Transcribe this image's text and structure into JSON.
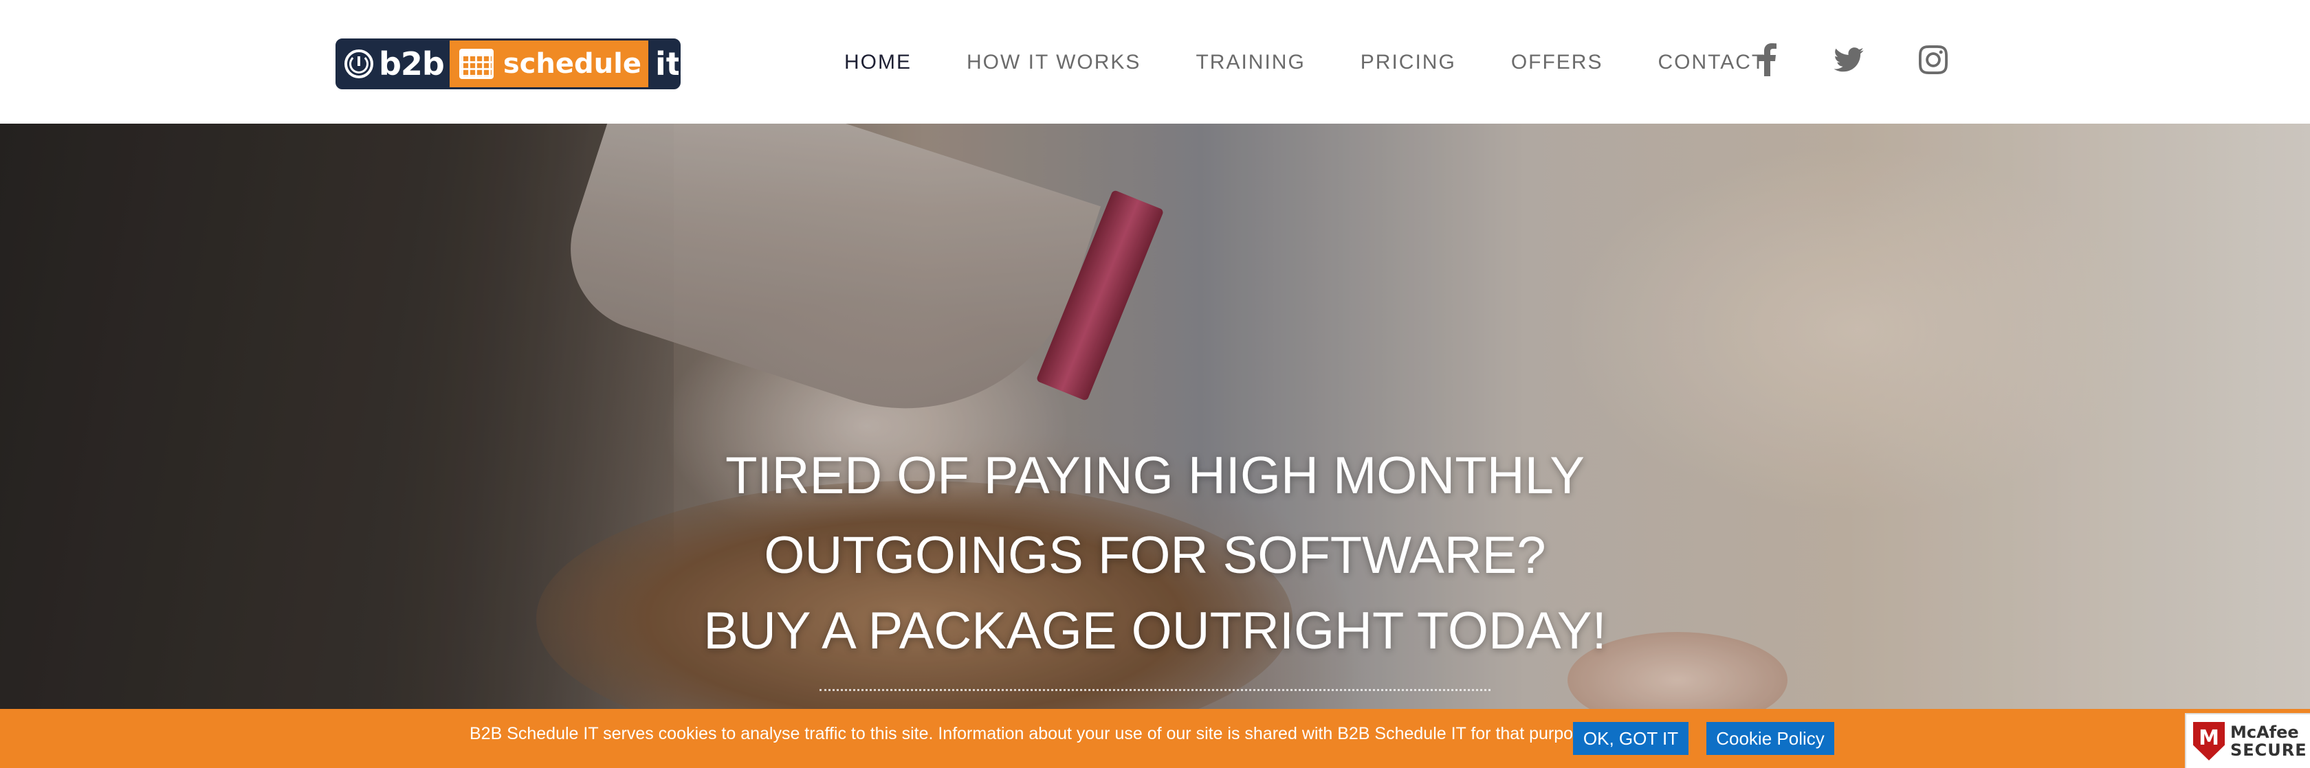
{
  "header": {
    "logo": {
      "part1": "b2b",
      "part2": "schedule",
      "part3": "it"
    },
    "nav": [
      {
        "label": "HOME",
        "active": true
      },
      {
        "label": "HOW IT WORKS",
        "active": false
      },
      {
        "label": "TRAINING",
        "active": false
      },
      {
        "label": "PRICING",
        "active": false
      },
      {
        "label": "OFFERS",
        "active": false
      },
      {
        "label": "CONTACT",
        "active": false
      }
    ],
    "social": [
      "facebook-icon",
      "twitter-icon",
      "instagram-icon"
    ]
  },
  "hero": {
    "line1": "TIRED OF PAYING HIGH MONTHLY",
    "line2": "OUTGOINGS FOR SOFTWARE?",
    "line3": "BUY A PACKAGE OUTRIGHT TODAY!"
  },
  "cookie_bar": {
    "message": "B2B Schedule IT serves cookies to analyse traffic to this site. Information about your use of our site is shared with B2B Schedule IT for that purpose.",
    "ok_label": "OK, GOT IT",
    "policy_label": "Cookie Policy"
  },
  "badge": {
    "line1": "McAfee",
    "line2": "SECURE"
  },
  "colors": {
    "accent_orange": "#ef8524",
    "logo_navy": "#1c2a43",
    "button_blue": "#0e70c6",
    "nav_text": "#6b6b6b",
    "nav_active": "#1d1f33"
  }
}
